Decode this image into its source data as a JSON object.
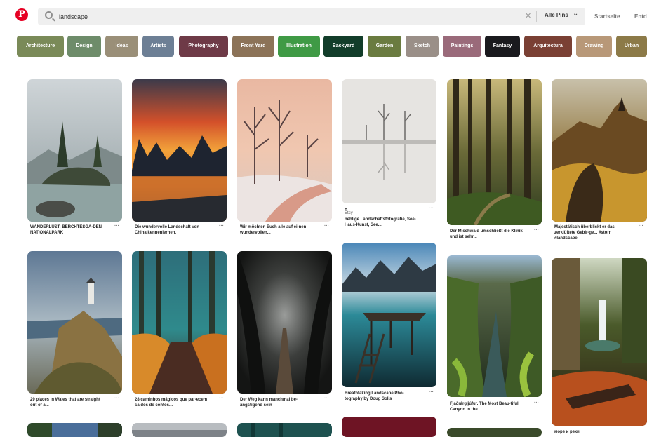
{
  "header": {
    "logo": "P",
    "search_value": "landscape",
    "clear_icon": "close-icon",
    "scope_label": "Alle Pins",
    "nav": [
      "Startseite",
      "Entd"
    ]
  },
  "guides": [
    {
      "label": "Architecture",
      "color": "#7a8a58"
    },
    {
      "label": "Design",
      "color": "#6e8c6a"
    },
    {
      "label": "Ideas",
      "color": "#9a8f78"
    },
    {
      "label": "Artists",
      "color": "#6d7f95"
    },
    {
      "label": "Photography",
      "color": "#6e3a47"
    },
    {
      "label": "Front Yard",
      "color": "#8c7358"
    },
    {
      "label": "Illustration",
      "color": "#3f9a45"
    },
    {
      "label": "Backyard",
      "color": "#123d2a"
    },
    {
      "label": "Garden",
      "color": "#6a7b40"
    },
    {
      "label": "Sketch",
      "color": "#9a8f88"
    },
    {
      "label": "Paintings",
      "color": "#9a6a7a"
    },
    {
      "label": "Fantasy",
      "color": "#1a1a1e"
    },
    {
      "label": "Arquitectura",
      "color": "#7a4034"
    },
    {
      "label": "Drawing",
      "color": "#b89878"
    },
    {
      "label": "Urban",
      "color": "#8c7a48"
    }
  ],
  "pins": [
    {
      "title": "WANDERLUST: BERCHTESGA-DEN NATIONALPARK",
      "source": ""
    },
    {
      "title": "Die wundervolle Landschaft von China kennenlernen.",
      "source": ""
    },
    {
      "title": "Wir möchten Euch alle auf ei-nen wundervollen...",
      "source": ""
    },
    {
      "title": "neblige Landschaftsfotografie, See-Haus-Kunst, See...",
      "source": "Etsy"
    },
    {
      "title": "Der Mischwald umschließt die Klinik und ist sehr...",
      "source": ""
    },
    {
      "title": "Majestätisch überblickt er das zerklüftete Gebir-ge... #storr #landscape",
      "source": ""
    },
    {
      "title": "29 places in Wales that are straight out of a...",
      "source": ""
    },
    {
      "title": "28 caminhos mágicos que par-ecem saídos de contos...",
      "source": ""
    },
    {
      "title": "Der Weg kann manchmal be-ängstigend sein",
      "source": ""
    },
    {
      "title": "Breathtaking Landscape Pho-tography by Doug Solis",
      "source": ""
    },
    {
      "title": "Fjaðrárgljúfur, The Most Beau-tiful Canyon in the...",
      "source": ""
    },
    {
      "title": "море и реки",
      "source": ""
    }
  ],
  "more_icon": "ellipsis-icon"
}
